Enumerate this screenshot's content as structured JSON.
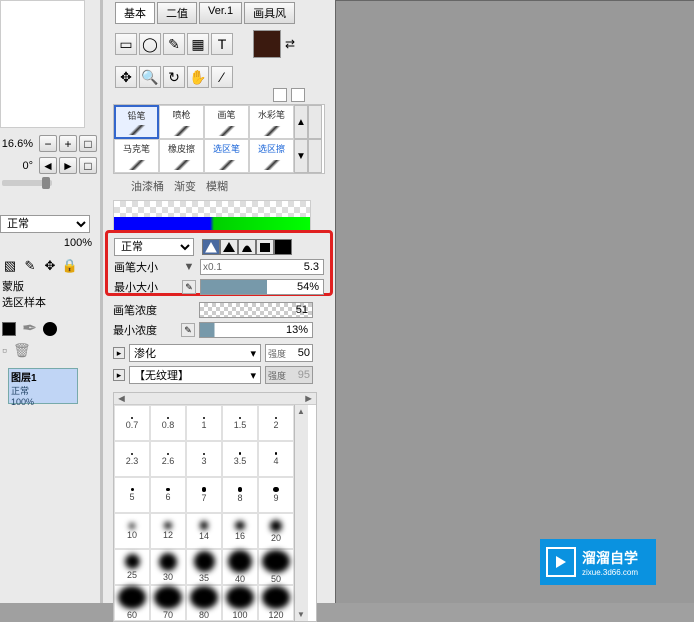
{
  "left": {
    "zoom": "16.6%",
    "rotation": "0°",
    "blend_mode": "正常",
    "opacity": "100%",
    "text1": "蒙版",
    "text2": "选区样本",
    "layer": {
      "name": "图层1",
      "mode": "正常",
      "opacity": "100%"
    }
  },
  "tabs": [
    "基本",
    "二值",
    "Ver.1",
    "画具风"
  ],
  "tools": {
    "row1": [
      "▭",
      "◯",
      "✎",
      "▦",
      "T"
    ],
    "row2": [
      "✥",
      "🔍",
      "↻",
      "✋",
      "⁄"
    ]
  },
  "color_swatch": "#3b1a0f",
  "brushes": [
    {
      "label": "铅笔",
      "selected": true
    },
    {
      "label": "喷枪"
    },
    {
      "label": "画笔"
    },
    {
      "label": "水彩笔"
    },
    {
      "label": "马克笔"
    },
    {
      "label": "橡皮擦"
    },
    {
      "label": "选区笔",
      "blue": true
    },
    {
      "label": "选区擦",
      "blue": true
    }
  ],
  "brush_row3": [
    "油漆桶",
    "渐变",
    "模糊"
  ],
  "highlighted": {
    "mode": "正常",
    "brush_size_label": "画笔大小",
    "brush_size_prefix": "x0.1",
    "brush_size_val": "5.3",
    "min_size_label": "最小大小",
    "min_size_val": "54%",
    "min_size_pct": 54
  },
  "below": {
    "density_label": "画笔浓度",
    "density_val": "51",
    "min_density_label": "最小浓度",
    "min_density_val": "13%",
    "min_density_pct": 13,
    "blur_label": "渗化",
    "blur_strength_label": "强度",
    "blur_strength_val": "50",
    "texture_label": "【无纹理】",
    "texture_strength_label": "强度",
    "texture_strength_val": "95"
  },
  "sizes": [
    [
      "0.7",
      "0.8",
      "1",
      "1.5",
      "2"
    ],
    [
      "2.3",
      "2.6",
      "3",
      "3.5",
      "4"
    ],
    [
      "5",
      "6",
      "7",
      "8",
      "9"
    ],
    [
      "10",
      "12",
      "14",
      "16",
      "20"
    ],
    [
      "25",
      "30",
      "35",
      "40",
      "50"
    ],
    [
      "60",
      "70",
      "80",
      "100",
      "120"
    ]
  ],
  "watermark": {
    "brand": "溜溜自学",
    "sub": "zixue.3d66.com"
  }
}
